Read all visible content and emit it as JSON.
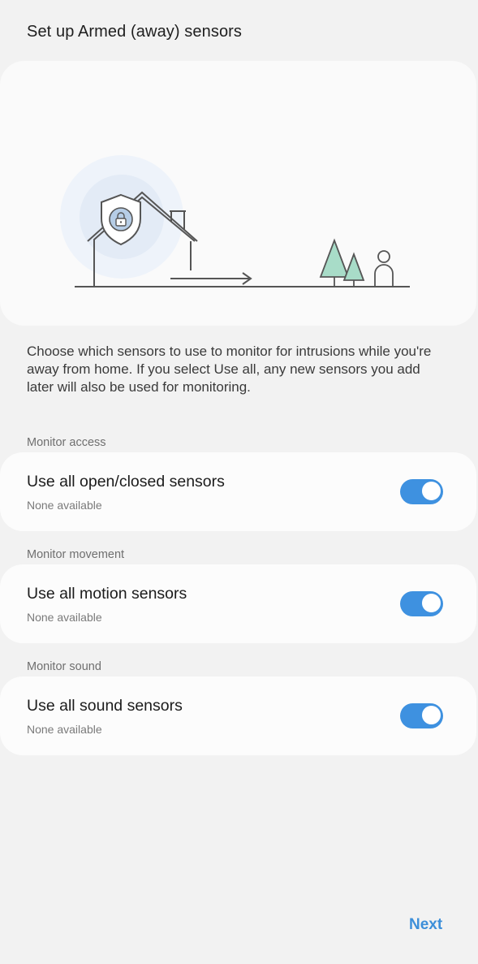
{
  "header": {
    "title": "Set up Armed (away) sensors"
  },
  "description": "Choose which sensors to use to monitor for intrusions while you're away from home. If you select Use all, any new sensors you add later will also be used for monitoring.",
  "sections": [
    {
      "label": "Monitor access",
      "title": "Use all open/closed sensors",
      "subtitle": "None available",
      "enabled": true
    },
    {
      "label": "Monitor movement",
      "title": "Use all motion sensors",
      "subtitle": "None available",
      "enabled": true
    },
    {
      "label": "Monitor sound",
      "title": "Use all sound sensors",
      "subtitle": "None available",
      "enabled": true
    }
  ],
  "footer": {
    "next_label": "Next"
  },
  "colors": {
    "accent": "#3e91e0",
    "tree": "#a8dcc8",
    "shield_glow": "#dce8f6"
  }
}
